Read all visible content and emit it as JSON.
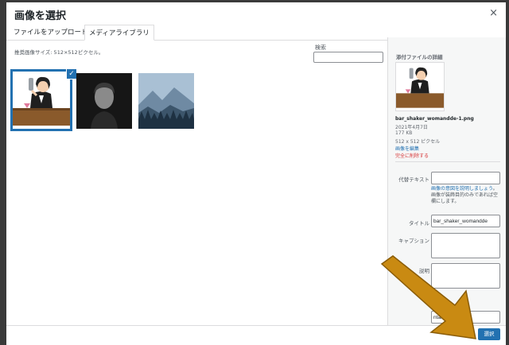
{
  "modal": {
    "title": "画像を選択",
    "close_icon": "×"
  },
  "tabs": [
    {
      "label": "ファイルをアップロード"
    },
    {
      "label": "メディアライブラリ"
    }
  ],
  "library": {
    "recommended_size": "推奨画像サイズ: 512×512ピクセル。",
    "search_label": "検索",
    "search_value": ""
  },
  "attachment": {
    "heading": "添付ファイルの詳細",
    "filename": "bar_shaker_womandde-1.png",
    "date": "2021年4月7日",
    "filesize": "177 KB",
    "dimensions": "512 x 512 ピクセル",
    "edit_link": "画像を編集",
    "delete_link": "完全に削除する"
  },
  "fields": {
    "alt_label": "代替テキスト",
    "alt_value": "",
    "alt_help_link": "画像の意図を説明しましょう",
    "alt_help_text": "。画像が装飾目的のみであれば空欄にします。",
    "title_label": "タイトル",
    "title_value": "bar_shaker_womandde",
    "caption_label": "キャプション",
    "caption_value": "",
    "desc_label": "説明",
    "desc_value": "",
    "url_value": "ntandk.fi"
  },
  "footer": {
    "select_label": "選択"
  },
  "colors": {
    "accent": "#2271b1",
    "danger": "#d63638",
    "arrow": "#c98a12"
  }
}
